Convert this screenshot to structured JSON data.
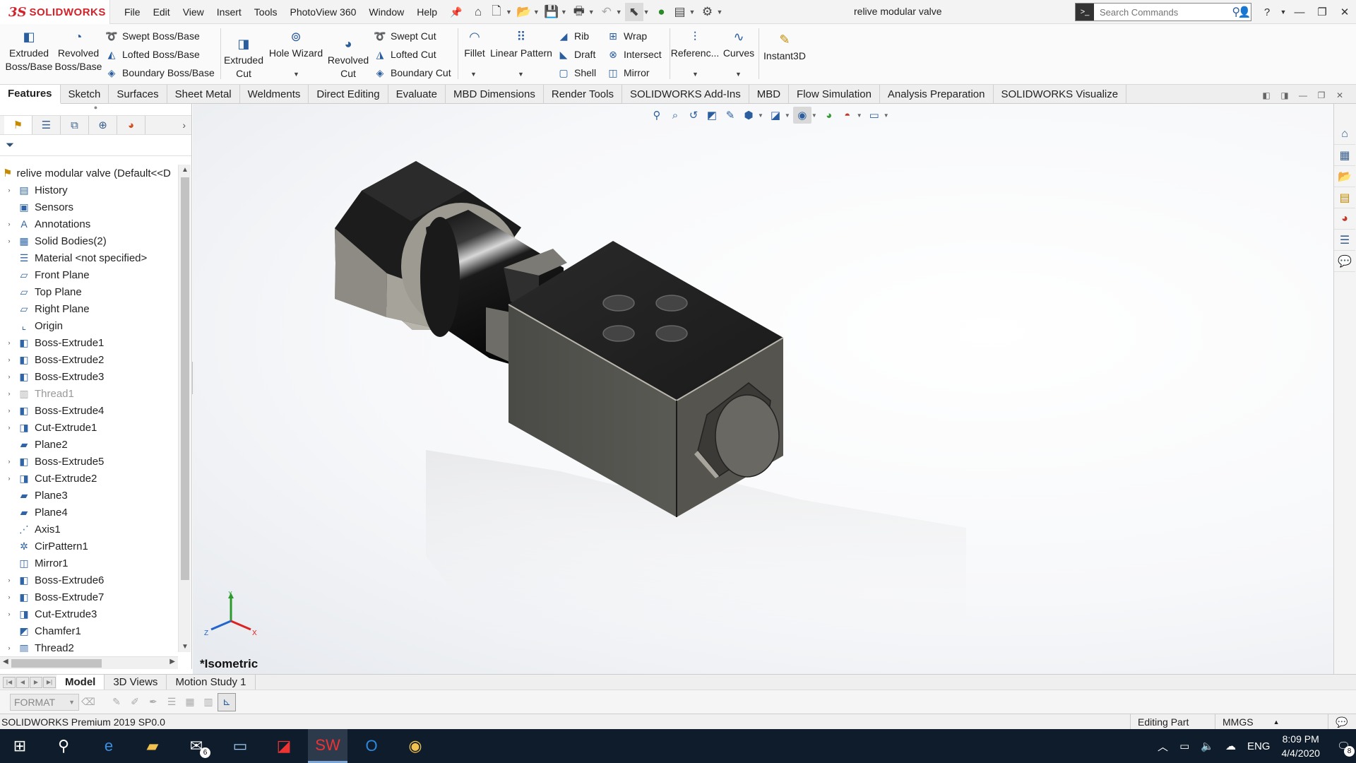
{
  "app": {
    "brand_ds": "3S",
    "brand_name": "SOLIDWORKS",
    "document_title": "relive modular valve"
  },
  "menu": [
    "File",
    "Edit",
    "View",
    "Insert",
    "Tools",
    "PhotoView 360",
    "Window",
    "Help"
  ],
  "search": {
    "placeholder": "Search Commands"
  },
  "ribbon": {
    "extruded_boss": "Extruded Boss/Base",
    "revolved_boss": "Revolved Boss/Base",
    "swept_boss": "Swept Boss/Base",
    "lofted_boss": "Lofted Boss/Base",
    "boundary_boss": "Boundary Boss/Base",
    "extruded_cut": "Extruded Cut",
    "hole_wizard": "Hole Wizard",
    "revolved_cut": "Revolved Cut",
    "swept_cut": "Swept Cut",
    "lofted_cut": "Lofted Cut",
    "boundary_cut": "Boundary Cut",
    "fillet": "Fillet",
    "linear_pattern": "Linear Pattern",
    "rib": "Rib",
    "draft": "Draft",
    "shell": "Shell",
    "wrap": "Wrap",
    "intersect": "Intersect",
    "mirror": "Mirror",
    "reference": "Referenc...",
    "curves": "Curves",
    "instant3d": "Instant3D"
  },
  "command_tabs": [
    "Features",
    "Sketch",
    "Surfaces",
    "Sheet Metal",
    "Weldments",
    "Direct Editing",
    "Evaluate",
    "MBD Dimensions",
    "Render Tools",
    "SOLIDWORKS Add-Ins",
    "MBD",
    "Flow Simulation",
    "Analysis Preparation",
    "SOLIDWORKS Visualize"
  ],
  "tree": {
    "root": "relive modular valve  (Default<<D",
    "items": [
      {
        "label": "History",
        "icon": "history-icon",
        "glyph": "▤",
        "exp": "›"
      },
      {
        "label": "Sensors",
        "icon": "sensor-icon",
        "glyph": "▣",
        "exp": ""
      },
      {
        "label": "Annotations",
        "icon": "annotations-icon",
        "glyph": "A",
        "exp": "›"
      },
      {
        "label": "Solid Bodies(2)",
        "icon": "solid-bodies-icon",
        "glyph": "▦",
        "exp": "›"
      },
      {
        "label": "Material <not specified>",
        "icon": "material-icon",
        "glyph": "☰",
        "exp": ""
      },
      {
        "label": "Front Plane",
        "icon": "plane-icon",
        "glyph": "▱",
        "exp": ""
      },
      {
        "label": "Top Plane",
        "icon": "plane-icon",
        "glyph": "▱",
        "exp": ""
      },
      {
        "label": "Right Plane",
        "icon": "plane-icon",
        "glyph": "▱",
        "exp": ""
      },
      {
        "label": "Origin",
        "icon": "origin-icon",
        "glyph": "⌞",
        "exp": ""
      },
      {
        "label": "Boss-Extrude1",
        "icon": "boss-extrude-icon",
        "glyph": "◧",
        "exp": "›"
      },
      {
        "label": "Boss-Extrude2",
        "icon": "boss-extrude-icon",
        "glyph": "◧",
        "exp": "›"
      },
      {
        "label": "Boss-Extrude3",
        "icon": "boss-extrude-icon",
        "glyph": "◧",
        "exp": "›"
      },
      {
        "label": "Thread1",
        "icon": "thread-icon",
        "glyph": "▥",
        "exp": "›",
        "dim": true
      },
      {
        "label": "Boss-Extrude4",
        "icon": "boss-extrude-icon",
        "glyph": "◧",
        "exp": "›"
      },
      {
        "label": "Cut-Extrude1",
        "icon": "cut-extrude-icon",
        "glyph": "◨",
        "exp": "›"
      },
      {
        "label": "Plane2",
        "icon": "plane-icon",
        "glyph": "▰",
        "exp": ""
      },
      {
        "label": "Boss-Extrude5",
        "icon": "boss-extrude-icon",
        "glyph": "◧",
        "exp": "›"
      },
      {
        "label": "Cut-Extrude2",
        "icon": "cut-extrude-icon",
        "glyph": "◨",
        "exp": "›"
      },
      {
        "label": "Plane3",
        "icon": "plane-icon",
        "glyph": "▰",
        "exp": ""
      },
      {
        "label": "Plane4",
        "icon": "plane-icon",
        "glyph": "▰",
        "exp": ""
      },
      {
        "label": "Axis1",
        "icon": "axis-icon",
        "glyph": "⋰",
        "exp": ""
      },
      {
        "label": "CirPattern1",
        "icon": "circular-pattern-icon",
        "glyph": "✲",
        "exp": ""
      },
      {
        "label": "Mirror1",
        "icon": "mirror-icon",
        "glyph": "◫",
        "exp": ""
      },
      {
        "label": "Boss-Extrude6",
        "icon": "boss-extrude-icon",
        "glyph": "◧",
        "exp": "›"
      },
      {
        "label": "Boss-Extrude7",
        "icon": "boss-extrude-icon",
        "glyph": "◧",
        "exp": "›"
      },
      {
        "label": "Cut-Extrude3",
        "icon": "cut-extrude-icon",
        "glyph": "◨",
        "exp": "›"
      },
      {
        "label": "Chamfer1",
        "icon": "chamfer-icon",
        "glyph": "◩",
        "exp": ""
      },
      {
        "label": "Thread2",
        "icon": "thread-icon",
        "glyph": "▥",
        "exp": "›"
      }
    ]
  },
  "viewport": {
    "view_name": "*Isometric",
    "triad_y": "Y",
    "triad_x": "X",
    "triad_z": "Z"
  },
  "bottom_tabs": [
    "Model",
    "3D Views",
    "Motion Study 1"
  ],
  "format_bar": {
    "format_label": "FORMAT"
  },
  "status": {
    "message": "SOLIDWORKS Premium 2019 SP0.0",
    "mode": "Editing Part",
    "units": "MMGS"
  },
  "taskbar": {
    "mail_badge": "6",
    "lang": "ENG",
    "time": "8:09 PM",
    "date": "4/4/2020",
    "notif_badge": "8"
  }
}
